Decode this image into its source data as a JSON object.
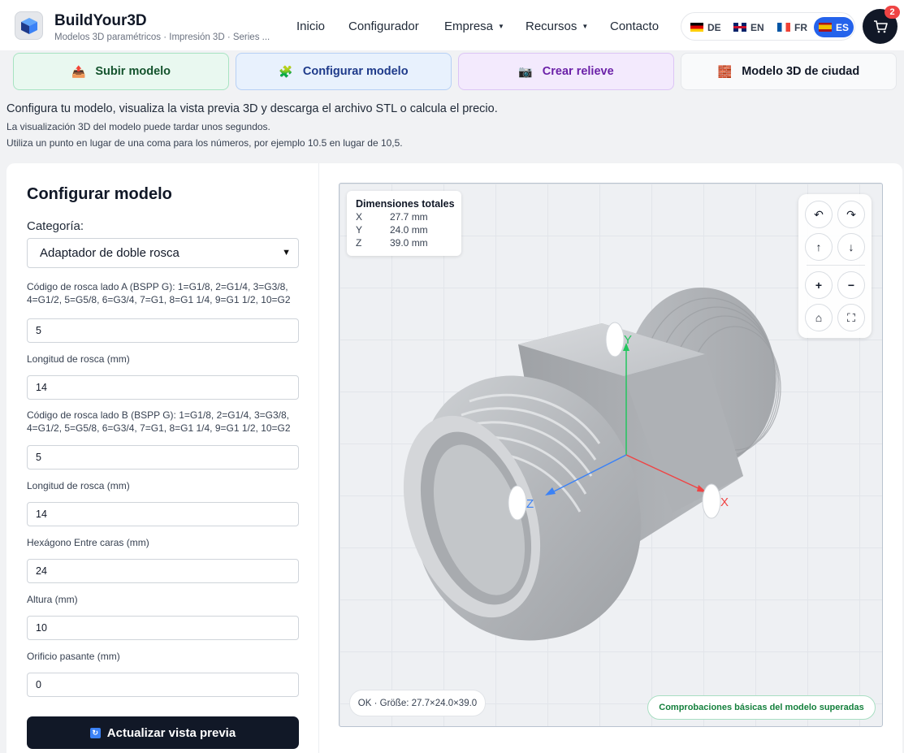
{
  "header": {
    "brand_title": "BuildYour3D",
    "brand_subtitle": "Modelos 3D paramétricos · Impresión 3D · Series ...",
    "nav": [
      {
        "label": "Inicio"
      },
      {
        "label": "Configurador"
      },
      {
        "label": "Empresa",
        "has_dropdown": true
      },
      {
        "label": "Recursos",
        "has_dropdown": true
      },
      {
        "label": "Contacto"
      }
    ],
    "languages": [
      {
        "code": "DE",
        "flag": "de-flag-icon",
        "active": false
      },
      {
        "code": "EN",
        "flag": "uk-flag-icon",
        "active": false
      },
      {
        "code": "FR",
        "flag": "fr-flag-icon",
        "active": false
      },
      {
        "code": "ES",
        "flag": "es-flag-icon",
        "active": true
      }
    ],
    "cart_count": "2"
  },
  "tabs": [
    {
      "label": "Subir modelo",
      "icon": "upload-box-icon"
    },
    {
      "label": "Configurar modelo",
      "icon": "puzzle-icon"
    },
    {
      "label": "Crear relieve",
      "icon": "camera-icon"
    },
    {
      "label": "Modelo 3D de ciudad",
      "icon": "brick-icon"
    }
  ],
  "info": {
    "line1": "Configura tu modelo, visualiza la vista previa 3D y descarga el archivo STL o calcula el precio.",
    "line2": "La visualización 3D del modelo puede tardar unos segundos.",
    "line3": "Utiliza un punto en lugar de una coma para los números, por ejemplo 10.5 en lugar de 10,5."
  },
  "form": {
    "title": "Configurar modelo",
    "category_label": "Categoría:",
    "category_value": "Adaptador de doble rosca",
    "fields": [
      {
        "label_l1": "Código de rosca lado A (BSPP G): 1=G1/8, 2=G1/4, 3=G3/8,",
        "label_l2": "4=G1/2, 5=G5/8, 6=G3/4, 7=G1, 8=G1 1/4, 9=G1 1/2, 10=G2",
        "value": "5"
      },
      {
        "label_l1": "Longitud de rosca (mm)",
        "value": "14"
      },
      {
        "label_l1": "Código de rosca lado B (BSPP G): 1=G1/8, 2=G1/4, 3=G3/8,",
        "label_l2": "4=G1/2, 5=G5/8, 6=G3/4, 7=G1, 8=G1 1/4, 9=G1 1/2, 10=G2",
        "value": "5"
      },
      {
        "label_l1": "Longitud de rosca (mm)",
        "value": "14"
      },
      {
        "label_l1": "Hexágono Entre caras (mm)",
        "value": "24"
      },
      {
        "label_l1": "Altura (mm)",
        "value": "10"
      },
      {
        "label_l1": "Orificio pasante (mm)",
        "value": "0"
      }
    ],
    "update_button": "Actualizar vista previa"
  },
  "viewer": {
    "dims_title": "Dimensiones totales",
    "dims": [
      {
        "axis": "X",
        "value": "27.7 mm"
      },
      {
        "axis": "Y",
        "value": "24.0 mm"
      },
      {
        "axis": "Z",
        "value": "39.0 mm"
      }
    ],
    "axis_labels": {
      "x": "X",
      "y": "Y",
      "z": "Z"
    },
    "axis_colors": {
      "x": "#ef4444",
      "y": "#22c55e",
      "z": "#3b82f6"
    },
    "controls": {
      "rotate_left": "↶",
      "rotate_right": "↷",
      "tilt_up": "↑",
      "tilt_down": "↓",
      "zoom_in": "+",
      "zoom_out": "−",
      "home": "⌂",
      "fullscreen": "⛶"
    },
    "status_left": "OK · Größe: 27.7×24.0×39.0",
    "status_right": "Comprobaciones básicas del modelo superadas"
  }
}
